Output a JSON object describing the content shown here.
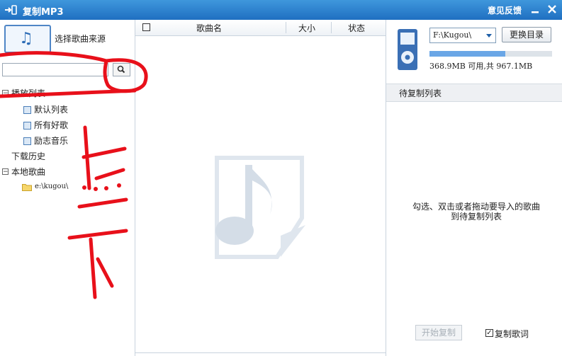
{
  "window": {
    "title": "复制MP3",
    "feedback": "意见反馈",
    "icons": [
      "import-arrow-icon",
      "minimize-icon",
      "close-icon"
    ]
  },
  "left_panel": {
    "source_label": "选择歌曲来源",
    "search_placeholder": "",
    "tree": {
      "playlists_label": "播放列表",
      "default_list": "默认列表",
      "all_favorites": "所有好歌",
      "motivational": "励志音乐",
      "download_history": "下载历史",
      "local_songs": "本地歌曲",
      "local_folder": "e:\\kugou\\"
    }
  },
  "center_panel": {
    "columns": {
      "song_name": "歌曲名",
      "size": "大小",
      "status": "状态"
    }
  },
  "right_panel": {
    "drive_select": "F:\\Kugou\\",
    "change_dir_button": "更换目录",
    "storage_fill_fraction": 0.62,
    "storage_text": "368.9MB 可用,共 967.1MB",
    "pending_header": "待复制列表",
    "hint_line1": "勾选、双击或者拖动要导入的歌曲",
    "hint_line2": "到待复制列表",
    "start_button": "开始复制",
    "copy_lyrics_label": "复制歌词",
    "copy_lyrics_checked": true
  },
  "annotation": {
    "text": "点下",
    "color": "#e8101a"
  },
  "colors": {
    "titlebar": "#2a7fd0",
    "accent": "#6aa6e6",
    "annotation": "#e8101a"
  }
}
